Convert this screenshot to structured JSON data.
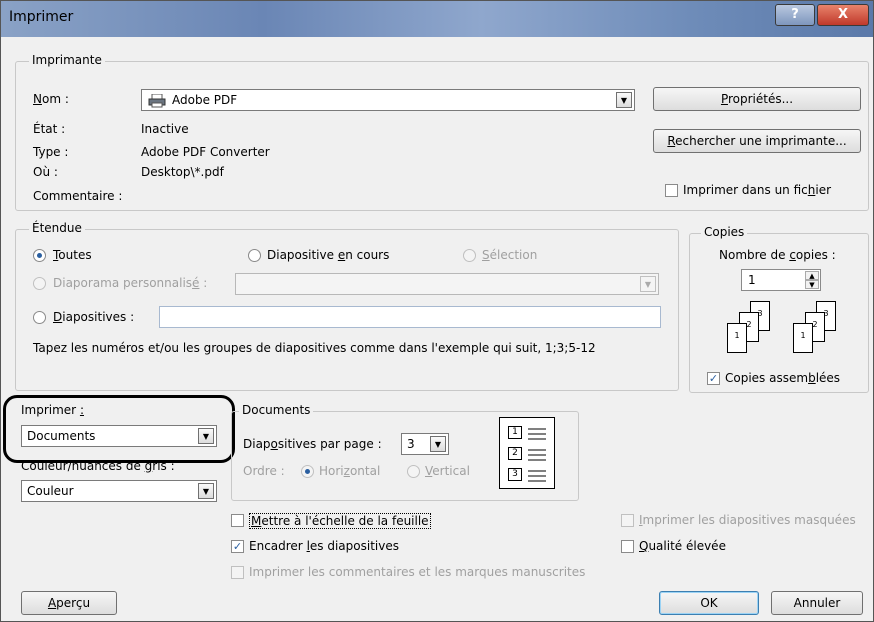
{
  "window": {
    "title": "Imprimer",
    "help_glyph": "?",
    "close_glyph": "X"
  },
  "printer": {
    "legend": "Imprimante",
    "name_label": "Nom :",
    "name_value": "Adobe PDF",
    "state_label": "État :",
    "state_value": "Inactive",
    "type_label": "Type :",
    "type_value": "Adobe PDF Converter",
    "where_label": "Où :",
    "where_value": "Desktop\\*.pdf",
    "comment_label": "Commentaire :",
    "properties_button": "Propriétés...",
    "find_button": "Rechercher une imprimante...",
    "print_to_file": {
      "label": "Imprimer dans un fichier",
      "checked": false
    }
  },
  "range": {
    "legend": "Étendue",
    "all": {
      "label": "Toutes",
      "selected": true
    },
    "current": {
      "label": "Diapositive en cours",
      "selected": false
    },
    "selection": {
      "label": "Sélection",
      "enabled": false
    },
    "custom": {
      "label": "Diaporama personnalisé :",
      "enabled": false
    },
    "slides": {
      "label": "Diapositives :",
      "value": ""
    },
    "hint": "Tapez les numéros et/ou les groupes de diapositives comme dans l'exemple qui suit, 1;3;5-12"
  },
  "copies": {
    "legend": "Copies",
    "count_label": "Nombre de copies :",
    "count_value": "1",
    "collate": {
      "label": "Copies assemblées",
      "checked": true
    },
    "page_numbers": [
      "1",
      "2",
      "3"
    ]
  },
  "print_what": {
    "label": "Imprimer :",
    "value": "Documents"
  },
  "color": {
    "label": "Couleur/nuances de gris :",
    "value": "Couleur"
  },
  "documents": {
    "legend": "Documents",
    "per_page_label": "Diapositives par page :",
    "per_page_value": "3",
    "order_label": "Ordre :",
    "horizontal": {
      "label": "Horizontal",
      "selected": true,
      "enabled": false
    },
    "vertical": {
      "label": "Vertical",
      "selected": false,
      "enabled": false
    },
    "preview_numbers": [
      "1",
      "2",
      "3"
    ]
  },
  "options": {
    "scale": {
      "label": "Mettre à l'échelle de la feuille",
      "checked": false
    },
    "frame": {
      "label": "Encadrer les diapositives",
      "checked": true
    },
    "comments": {
      "label": "Imprimer les commentaires et les marques manuscrites",
      "checked": false,
      "enabled": false
    },
    "hidden": {
      "label": "Imprimer les diapositives masquées",
      "checked": false,
      "enabled": false
    },
    "quality": {
      "label": "Qualité élevée",
      "checked": false
    }
  },
  "buttons": {
    "preview": "Aperçu",
    "ok": "OK",
    "cancel": "Annuler"
  }
}
